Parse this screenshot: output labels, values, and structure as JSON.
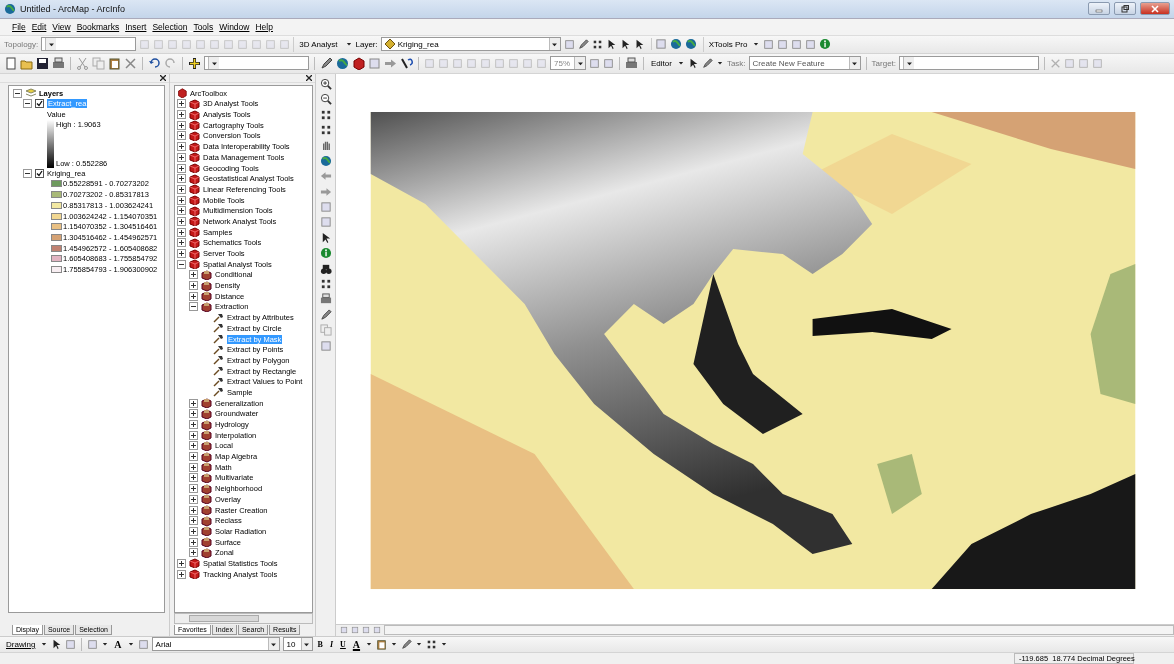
{
  "window": {
    "title": "Untitled - ArcMap - ArcInfo"
  },
  "menu": [
    "File",
    "Edit",
    "View",
    "Bookmarks",
    "Insert",
    "Selection",
    "Tools",
    "Window",
    "Help"
  ],
  "toolbar_1": {
    "topology_label": "Topology:",
    "analyst_menu": "3D Analyst",
    "layer_label": "Layer:",
    "layer_value": "Kriging_rea",
    "xtools_menu": "XTools Pro"
  },
  "toolbar_2": {
    "zoom_value": "75%",
    "editor_menu": "Editor",
    "task_label": "Task:",
    "task_value": "Create New Feature",
    "target_label": "Target:"
  },
  "toc": {
    "root": "Layers",
    "layers": [
      {
        "name": "Extract_rea",
        "kind": "stretch",
        "checked": true,
        "selected": true,
        "field": "Value",
        "high": "High : 1.9063",
        "low": "Low : 0.552286"
      },
      {
        "name": "Kriging_rea",
        "kind": "classes",
        "checked": true,
        "selected": false,
        "classes": [
          {
            "label": "0.55228591 - 0.70273202",
            "color": "#6e9a5e"
          },
          {
            "label": "0.70273202 - 0.85317813",
            "color": "#a9b978"
          },
          {
            "label": "0.85317813 - 1.003624241",
            "color": "#f2e8a2"
          },
          {
            "label": "1.003624242 - 1.154070351",
            "color": "#f1d792"
          },
          {
            "label": "1.154070352 - 1.304516461",
            "color": "#e9c083"
          },
          {
            "label": "1.304516462 - 1.454962571",
            "color": "#d5a274"
          },
          {
            "label": "1.454962572 - 1.605408682",
            "color": "#c08272"
          },
          {
            "label": "1.605408683 - 1.755854792",
            "color": "#e2b4c2"
          },
          {
            "label": "1.755854793 - 1.906300902",
            "color": "#f8eef2"
          }
        ]
      }
    ],
    "tabs": [
      {
        "label": "Display",
        "selected": true
      },
      {
        "label": "Source",
        "selected": false
      },
      {
        "label": "Selection",
        "selected": false
      }
    ]
  },
  "toolbox": {
    "root": "ArcToolbox",
    "items": [
      {
        "label": "3D Analyst Tools",
        "kind": "toolbox",
        "expanded": false,
        "selected": false
      },
      {
        "label": "Analysis Tools",
        "kind": "toolbox",
        "expanded": false,
        "selected": false
      },
      {
        "label": "Cartography Tools",
        "kind": "toolbox",
        "expanded": false,
        "selected": false
      },
      {
        "label": "Conversion Tools",
        "kind": "toolbox",
        "expanded": false,
        "selected": false
      },
      {
        "label": "Data Interoperability Tools",
        "kind": "toolbox",
        "expanded": false,
        "selected": false
      },
      {
        "label": "Data Management Tools",
        "kind": "toolbox",
        "expanded": false,
        "selected": false
      },
      {
        "label": "Geocoding Tools",
        "kind": "toolbox",
        "expanded": false,
        "selected": false
      },
      {
        "label": "Geostatistical Analyst Tools",
        "kind": "toolbox",
        "expanded": false,
        "selected": false
      },
      {
        "label": "Linear Referencing Tools",
        "kind": "toolbox",
        "expanded": false,
        "selected": false
      },
      {
        "label": "Mobile Tools",
        "kind": "toolbox",
        "expanded": false,
        "selected": false
      },
      {
        "label": "Multidimension Tools",
        "kind": "toolbox",
        "expanded": false,
        "selected": false
      },
      {
        "label": "Network Analyst Tools",
        "kind": "toolbox",
        "expanded": false,
        "selected": false
      },
      {
        "label": "Samples",
        "kind": "toolbox",
        "expanded": false,
        "selected": false
      },
      {
        "label": "Schematics Tools",
        "kind": "toolbox",
        "expanded": false,
        "selected": false
      },
      {
        "label": "Server Tools",
        "kind": "toolbox",
        "expanded": false,
        "selected": false
      },
      {
        "label": "Spatial Analyst Tools",
        "kind": "toolbox",
        "expanded": true,
        "selected": false,
        "children": [
          {
            "label": "Conditional",
            "kind": "toolset",
            "expanded": false,
            "selected": false
          },
          {
            "label": "Density",
            "kind": "toolset",
            "expanded": false,
            "selected": false
          },
          {
            "label": "Distance",
            "kind": "toolset",
            "expanded": false,
            "selected": false
          },
          {
            "label": "Extraction",
            "kind": "toolset",
            "expanded": true,
            "selected": false,
            "children": [
              {
                "label": "Extract by Attributes",
                "kind": "tool",
                "selected": false
              },
              {
                "label": "Extract by Circle",
                "kind": "tool",
                "selected": false
              },
              {
                "label": "Extract by Mask",
                "kind": "tool",
                "selected": true
              },
              {
                "label": "Extract by Points",
                "kind": "tool",
                "selected": false
              },
              {
                "label": "Extract by Polygon",
                "kind": "tool",
                "selected": false
              },
              {
                "label": "Extract by Rectangle",
                "kind": "tool",
                "selected": false
              },
              {
                "label": "Extract Values to Point",
                "kind": "tool",
                "selected": false
              },
              {
                "label": "Sample",
                "kind": "tool",
                "selected": false
              }
            ]
          },
          {
            "label": "Generalization",
            "kind": "toolset",
            "expanded": false,
            "selected": false
          },
          {
            "label": "Groundwater",
            "kind": "toolset",
            "expanded": false,
            "selected": false
          },
          {
            "label": "Hydrology",
            "kind": "toolset",
            "expanded": false,
            "selected": false
          },
          {
            "label": "Interpolation",
            "kind": "toolset",
            "expanded": false,
            "selected": false
          },
          {
            "label": "Local",
            "kind": "toolset",
            "expanded": false,
            "selected": false
          },
          {
            "label": "Map Algebra",
            "kind": "toolset",
            "expanded": false,
            "selected": false
          },
          {
            "label": "Math",
            "kind": "toolset",
            "expanded": false,
            "selected": false
          },
          {
            "label": "Multivariate",
            "kind": "toolset",
            "expanded": false,
            "selected": false
          },
          {
            "label": "Neighborhood",
            "kind": "toolset",
            "expanded": false,
            "selected": false
          },
          {
            "label": "Overlay",
            "kind": "toolset",
            "expanded": false,
            "selected": false
          },
          {
            "label": "Raster Creation",
            "kind": "toolset",
            "expanded": false,
            "selected": false
          },
          {
            "label": "Reclass",
            "kind": "toolset",
            "expanded": false,
            "selected": false
          },
          {
            "label": "Solar Radiation",
            "kind": "toolset",
            "expanded": false,
            "selected": false
          },
          {
            "label": "Surface",
            "kind": "toolset",
            "expanded": false,
            "selected": false
          },
          {
            "label": "Zonal",
            "kind": "toolset",
            "expanded": false,
            "selected": false
          }
        ]
      },
      {
        "label": "Spatial Statistics Tools",
        "kind": "toolbox",
        "expanded": false,
        "selected": false
      },
      {
        "label": "Tracking Analyst Tools",
        "kind": "toolbox",
        "expanded": false,
        "selected": false
      }
    ],
    "tabs": [
      {
        "label": "Favorites",
        "selected": true
      },
      {
        "label": "Index",
        "selected": false
      },
      {
        "label": "Search",
        "selected": false
      },
      {
        "label": "Results",
        "selected": false
      }
    ]
  },
  "drawing_bar": {
    "drawing_menu": "Drawing",
    "text_tool": "A",
    "font": "Arial",
    "size": "10",
    "bold": "B",
    "italic": "I",
    "underline": "U",
    "font_color": "A"
  },
  "status_bar": {
    "coordinates": "-119.685  18.774 Decimal Degrees"
  }
}
